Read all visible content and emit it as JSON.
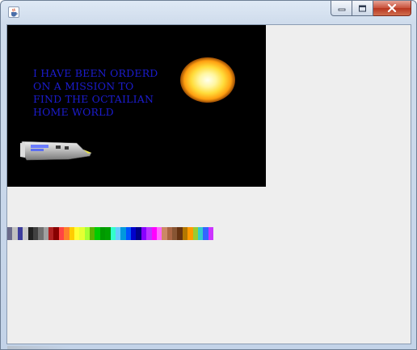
{
  "window": {
    "title": "",
    "app_icon": "java-coffee-cup-icon",
    "controls": {
      "minimize_icon": "minimize-icon",
      "maximize_icon": "maximize-icon",
      "close_icon": "close-icon"
    }
  },
  "game": {
    "background_color": "#000000",
    "text_color": "#1c1ccf",
    "story_text": "I HAVE BEEN ORDERD\nON A MISSION TO\nFIND THE OCTAILIAN\nHOME WORLD",
    "sun_icon": "sun-icon",
    "ship_icon": "spaceship-icon"
  },
  "palette": {
    "colors": [
      "#6a6a8a",
      "#c0c0c0",
      "#3c3c9c",
      "#c8c8c8",
      "#202020",
      "#404040",
      "#707070",
      "#a0a0a0",
      "#b02020",
      "#880000",
      "#ff4444",
      "#ff7f2a",
      "#ffcc00",
      "#ffff33",
      "#e6ff33",
      "#a6ff33",
      "#59b300",
      "#00cc00",
      "#009900",
      "#00a000",
      "#33ffcc",
      "#66ccff",
      "#0099dd",
      "#0055ff",
      "#0000cc",
      "#000088",
      "#8800ff",
      "#bb33ff",
      "#ff00ff",
      "#ff66ff",
      "#cc8866",
      "#aa6644",
      "#885533",
      "#663311",
      "#b37700",
      "#ff9900",
      "#99cc33",
      "#33cccc",
      "#3366ff",
      "#cc33ff"
    ]
  }
}
